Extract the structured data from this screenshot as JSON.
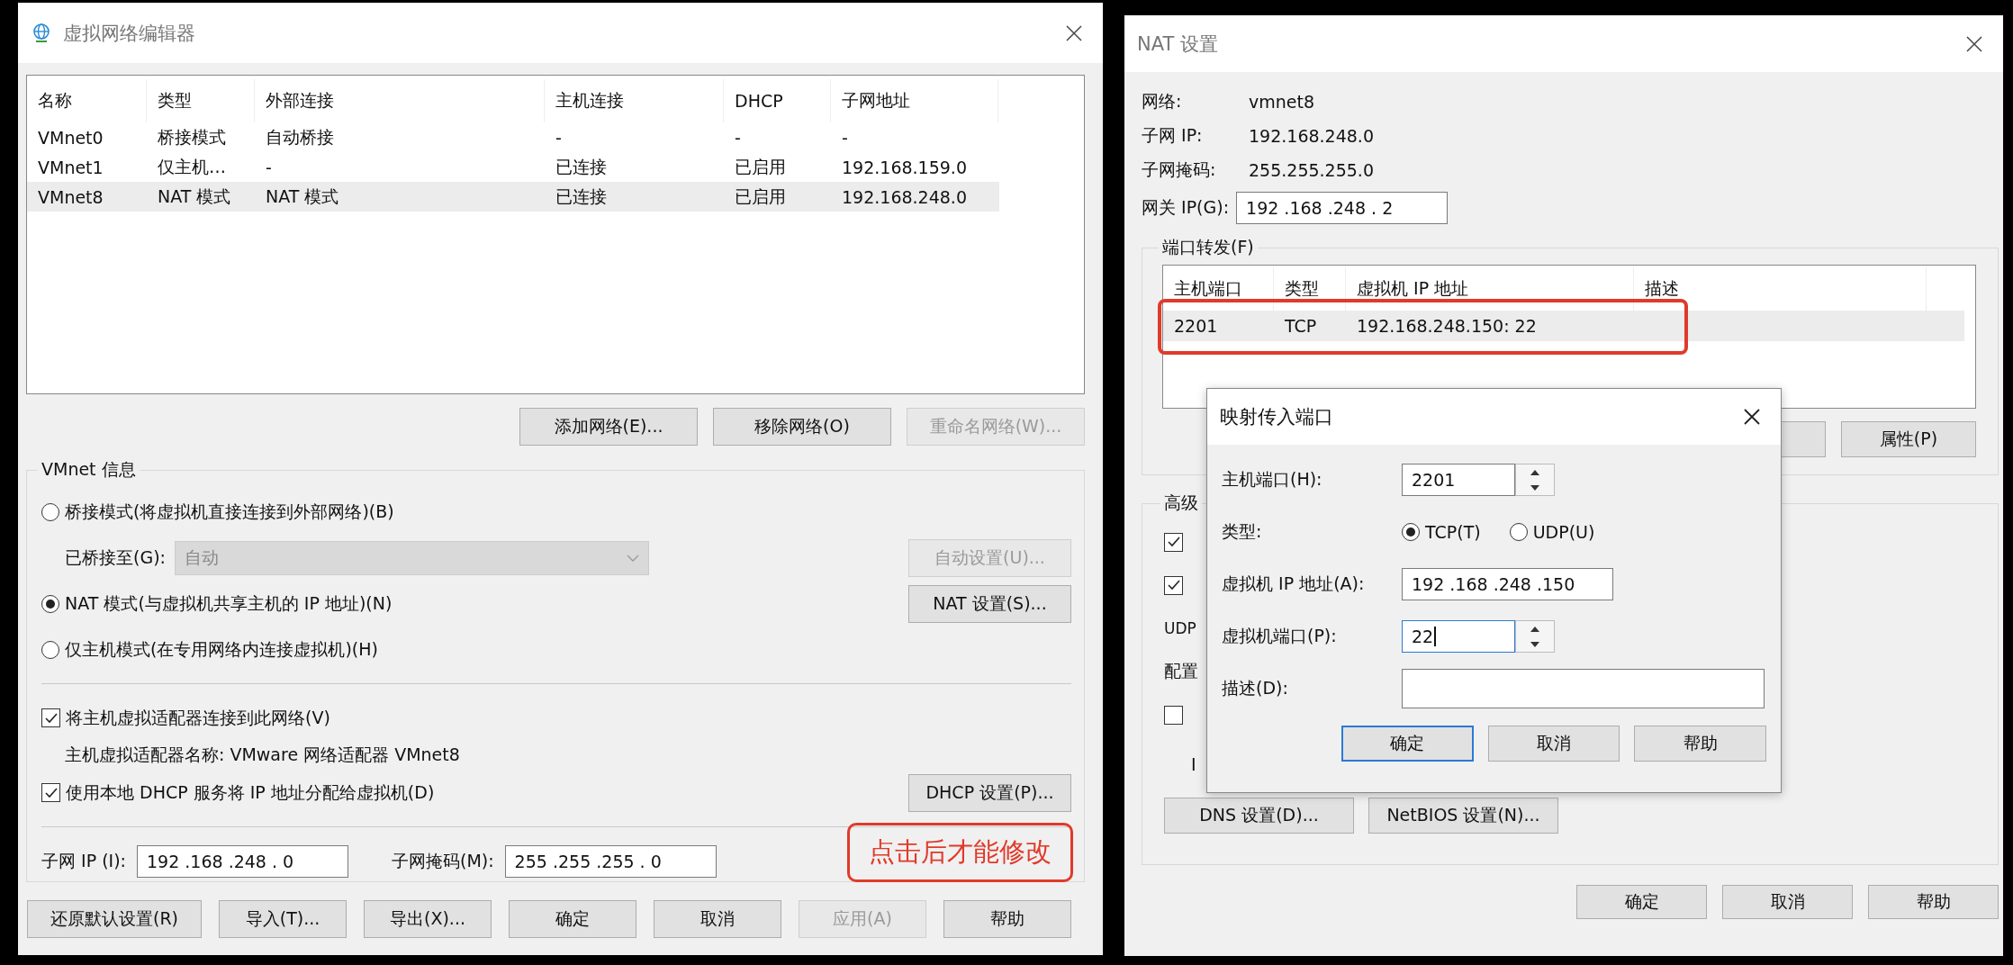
{
  "left_window": {
    "title": "虚拟网络编辑器",
    "table": {
      "columns": [
        "名称",
        "类型",
        "外部连接",
        "主机连接",
        "DHCP",
        "子网地址"
      ],
      "rows": [
        {
          "cells": [
            "VMnet0",
            "桥接模式",
            "自动桥接",
            "-",
            "-",
            "-"
          ],
          "selected": false
        },
        {
          "cells": [
            "VMnet1",
            "仅主机…",
            "-",
            "已连接",
            "已启用",
            "192.168.159.0"
          ],
          "selected": false
        },
        {
          "cells": [
            "VMnet8",
            "NAT 模式",
            "NAT 模式",
            "已连接",
            "已启用",
            "192.168.248.0"
          ],
          "selected": true
        }
      ]
    },
    "list_buttons": [
      {
        "label": "添加网络(E)...",
        "disabled": false
      },
      {
        "label": "移除网络(O)",
        "disabled": false
      },
      {
        "label": "重命名网络(W)...",
        "disabled": true
      }
    ],
    "vmnet_info": {
      "title": "VMnet 信息",
      "modes": [
        {
          "label": "桥接模式(将虚拟机直接连接到外部网络)(B)",
          "selected": false
        },
        {
          "label": "NAT 模式(与虚拟机共享主机的 IP 地址)(N)",
          "selected": true
        },
        {
          "label": "仅主机模式(在专用网络内连接虚拟机)(H)",
          "selected": false
        }
      ],
      "bridged_to": {
        "label": "已桥接至(G):",
        "value": "自动",
        "disabled": true
      },
      "auto_button": {
        "label": "自动设置(U)...",
        "disabled": true
      },
      "nat_button": {
        "label": "NAT 设置(S)...",
        "disabled": false
      },
      "connect_adapter": {
        "label": "将主机虚拟适配器连接到此网络(V)",
        "checked": true
      },
      "adapter_name": "主机虚拟适配器名称: VMware 网络适配器 VMnet8",
      "use_dhcp": {
        "label": "使用本地 DHCP 服务将 IP 地址分配给虚拟机(D)",
        "checked": true
      },
      "dhcp_button": {
        "label": "DHCP 设置(P)...",
        "disabled": false
      },
      "subnet_ip": {
        "label": "子网 IP (I):",
        "value": "192 .168 .248 . 0"
      },
      "subnet_mask": {
        "label": "子网掩码(M):",
        "value": "255 .255 .255 . 0"
      }
    },
    "annotation": "点击后才能修改",
    "footer_buttons": [
      {
        "label": "还原默认设置(R)",
        "disabled": false
      },
      {
        "label": "导入(T)...",
        "disabled": false
      },
      {
        "label": "导出(X)...",
        "disabled": false
      },
      {
        "label": "确定",
        "disabled": false
      },
      {
        "label": "取消",
        "disabled": false
      },
      {
        "label": "应用(A)",
        "disabled": true
      },
      {
        "label": "帮助",
        "disabled": false
      }
    ]
  },
  "nat_window": {
    "title": "NAT 设置",
    "info": [
      {
        "label": "网络:",
        "value": "vmnet8"
      },
      {
        "label": "子网 IP:",
        "value": "192.168.248.0"
      },
      {
        "label": "子网掩码:",
        "value": "255.255.255.0"
      }
    ],
    "gateway": {
      "label": "网关 IP(G):",
      "value": "192 .168 .248 . 2"
    },
    "port_forwarding": {
      "title": "端口转发(F)",
      "columns": [
        "主机端口",
        "类型",
        "虚拟机 IP 地址",
        "描述"
      ],
      "rows": [
        {
          "cells": [
            "2201",
            "TCP",
            "192.168.248.150: 22"
          ],
          "selected": true
        }
      ],
      "properties_button": "属性(P)"
    },
    "advanced": {
      "title": "高级",
      "checkboxes": [
        {
          "checked": true
        },
        {
          "checked": true
        }
      ],
      "udp_label": "UDP",
      "config_label": "配置",
      "extra_checkbox": {
        "checked": false
      },
      "ip_label": "I"
    },
    "buttons": [
      "DNS 设置(D)...",
      "NetBIOS 设置(N)..."
    ],
    "footer_buttons": [
      "确定",
      "取消",
      "帮助"
    ]
  },
  "mapping_dialog": {
    "title": "映射传入端口",
    "host_port": {
      "label": "主机端口(H):",
      "value": "2201",
      "focused": false
    },
    "type": {
      "label": "类型:",
      "options": [
        {
          "label": "TCP(T)",
          "selected": true
        },
        {
          "label": "UDP(U)",
          "selected": false
        }
      ]
    },
    "vm_ip": {
      "label": "虚拟机 IP 地址(A):",
      "value": "192 .168 .248 .150"
    },
    "vm_port": {
      "label": "虚拟机端口(P):",
      "value": "22",
      "focused": true
    },
    "description": {
      "label": "描述(D):"
    },
    "buttons": [
      {
        "label": "确定",
        "default": true
      },
      {
        "label": "取消",
        "default": false
      },
      {
        "label": "帮助",
        "default": false
      }
    ]
  }
}
